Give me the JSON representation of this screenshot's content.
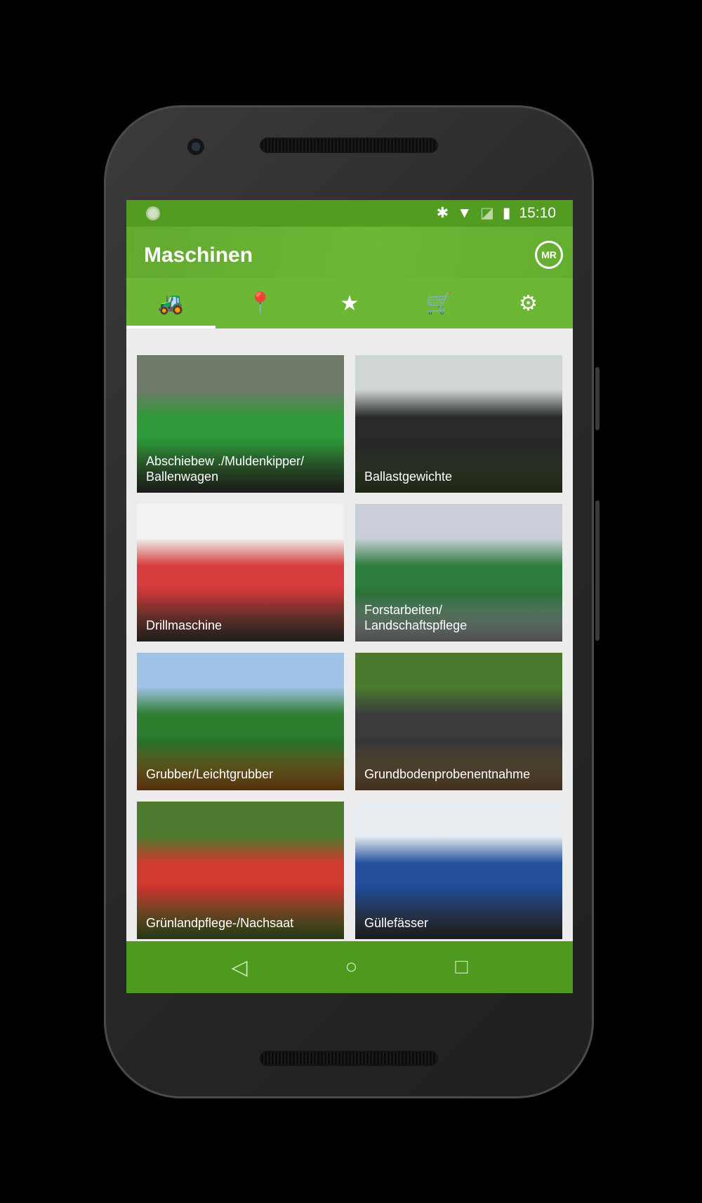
{
  "status_bar": {
    "time": "15:10",
    "icons": [
      "notification-dot-icon",
      "bluetooth-icon",
      "wifi-icon",
      "no-sim-icon",
      "battery-charging-icon"
    ]
  },
  "app_bar": {
    "title": "Maschinen",
    "logo_text": "MR"
  },
  "tabs": [
    {
      "name": "machines",
      "icon": "tractor-icon",
      "glyph": "🚜",
      "active": true
    },
    {
      "name": "location",
      "icon": "location-pin-icon",
      "glyph": "📍",
      "active": false
    },
    {
      "name": "favorites",
      "icon": "star-icon",
      "glyph": "★",
      "active": false
    },
    {
      "name": "cart",
      "icon": "cart-check-icon",
      "glyph": "🛒",
      "active": false
    },
    {
      "name": "settings",
      "icon": "gear-icon",
      "glyph": "⚙",
      "active": false
    }
  ],
  "cards": [
    {
      "label": "Abschiebew ./Muldenkipper/\nBallenwagen",
      "colors": [
        "#6f7a6a",
        "#2f9a3a",
        "#48503f"
      ]
    },
    {
      "label": "Ballastgewichte",
      "colors": [
        "#cfd6d5",
        "#2a2a2a",
        "#536a3a"
      ]
    },
    {
      "label": "Drillmaschine",
      "colors": [
        "#f2f2f2",
        "#d63c3c",
        "#5f5446"
      ]
    },
    {
      "label": "Forstarbeiten/\nLandschaftspflege",
      "colors": [
        "#c9ced8",
        "#2e7c3e",
        "#d9dbe0"
      ]
    },
    {
      "label": "Grubber/Leichtgrubber",
      "colors": [
        "#9fc2e6",
        "#2d7d2f",
        "#e6892a"
      ]
    },
    {
      "label": "Grundbodenprobenentnahme",
      "colors": [
        "#4b7a2e",
        "#3b3b3b",
        "#b18a54"
      ]
    },
    {
      "label": "Grünlandpflege-/Nachsaat",
      "colors": [
        "#4d7a2e",
        "#d13a2e",
        "#6a9b3a"
      ]
    },
    {
      "label": "Güllefässer",
      "colors": [
        "#e9eef2",
        "#234f9c",
        "#4d4d4d"
      ]
    }
  ],
  "nav_bar": {
    "back": "◁",
    "home": "○",
    "recents": "□"
  }
}
